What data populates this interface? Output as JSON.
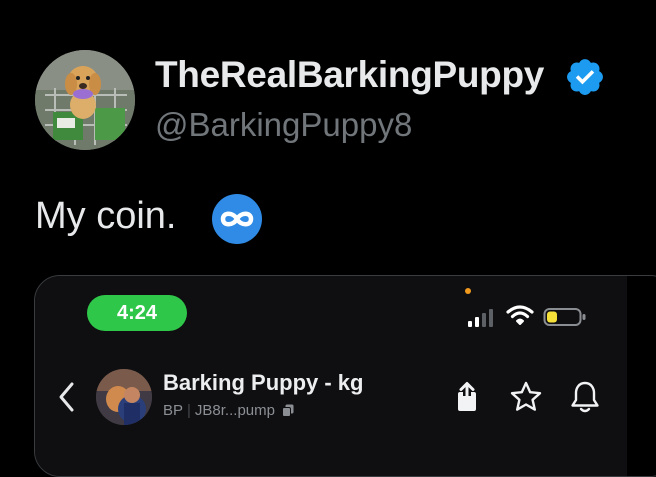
{
  "profile": {
    "display_name": "TheRealBarkingPuppy",
    "handle": "@BarkingPuppy8",
    "verified": true,
    "avatar_icon": "puppy-in-shopping-cart-photo"
  },
  "tweet": {
    "text": "My coin.",
    "emoji_icon": "infinity-icon"
  },
  "media": {
    "status_bar": {
      "time": "4:24",
      "time_pill_color": "#2fc749",
      "battery_color": "#f5e03a"
    },
    "token_header": {
      "name": "Barking Puppy - kg",
      "ticker": "BP",
      "separator": "|",
      "address": "JB8r...pump",
      "icons": [
        "back-chevron-icon",
        "share-icon",
        "star-icon",
        "bell-icon"
      ]
    }
  },
  "colors": {
    "background": "#000000",
    "verified_blue": "#1d9bf0",
    "secondary_text": "#71767b"
  }
}
